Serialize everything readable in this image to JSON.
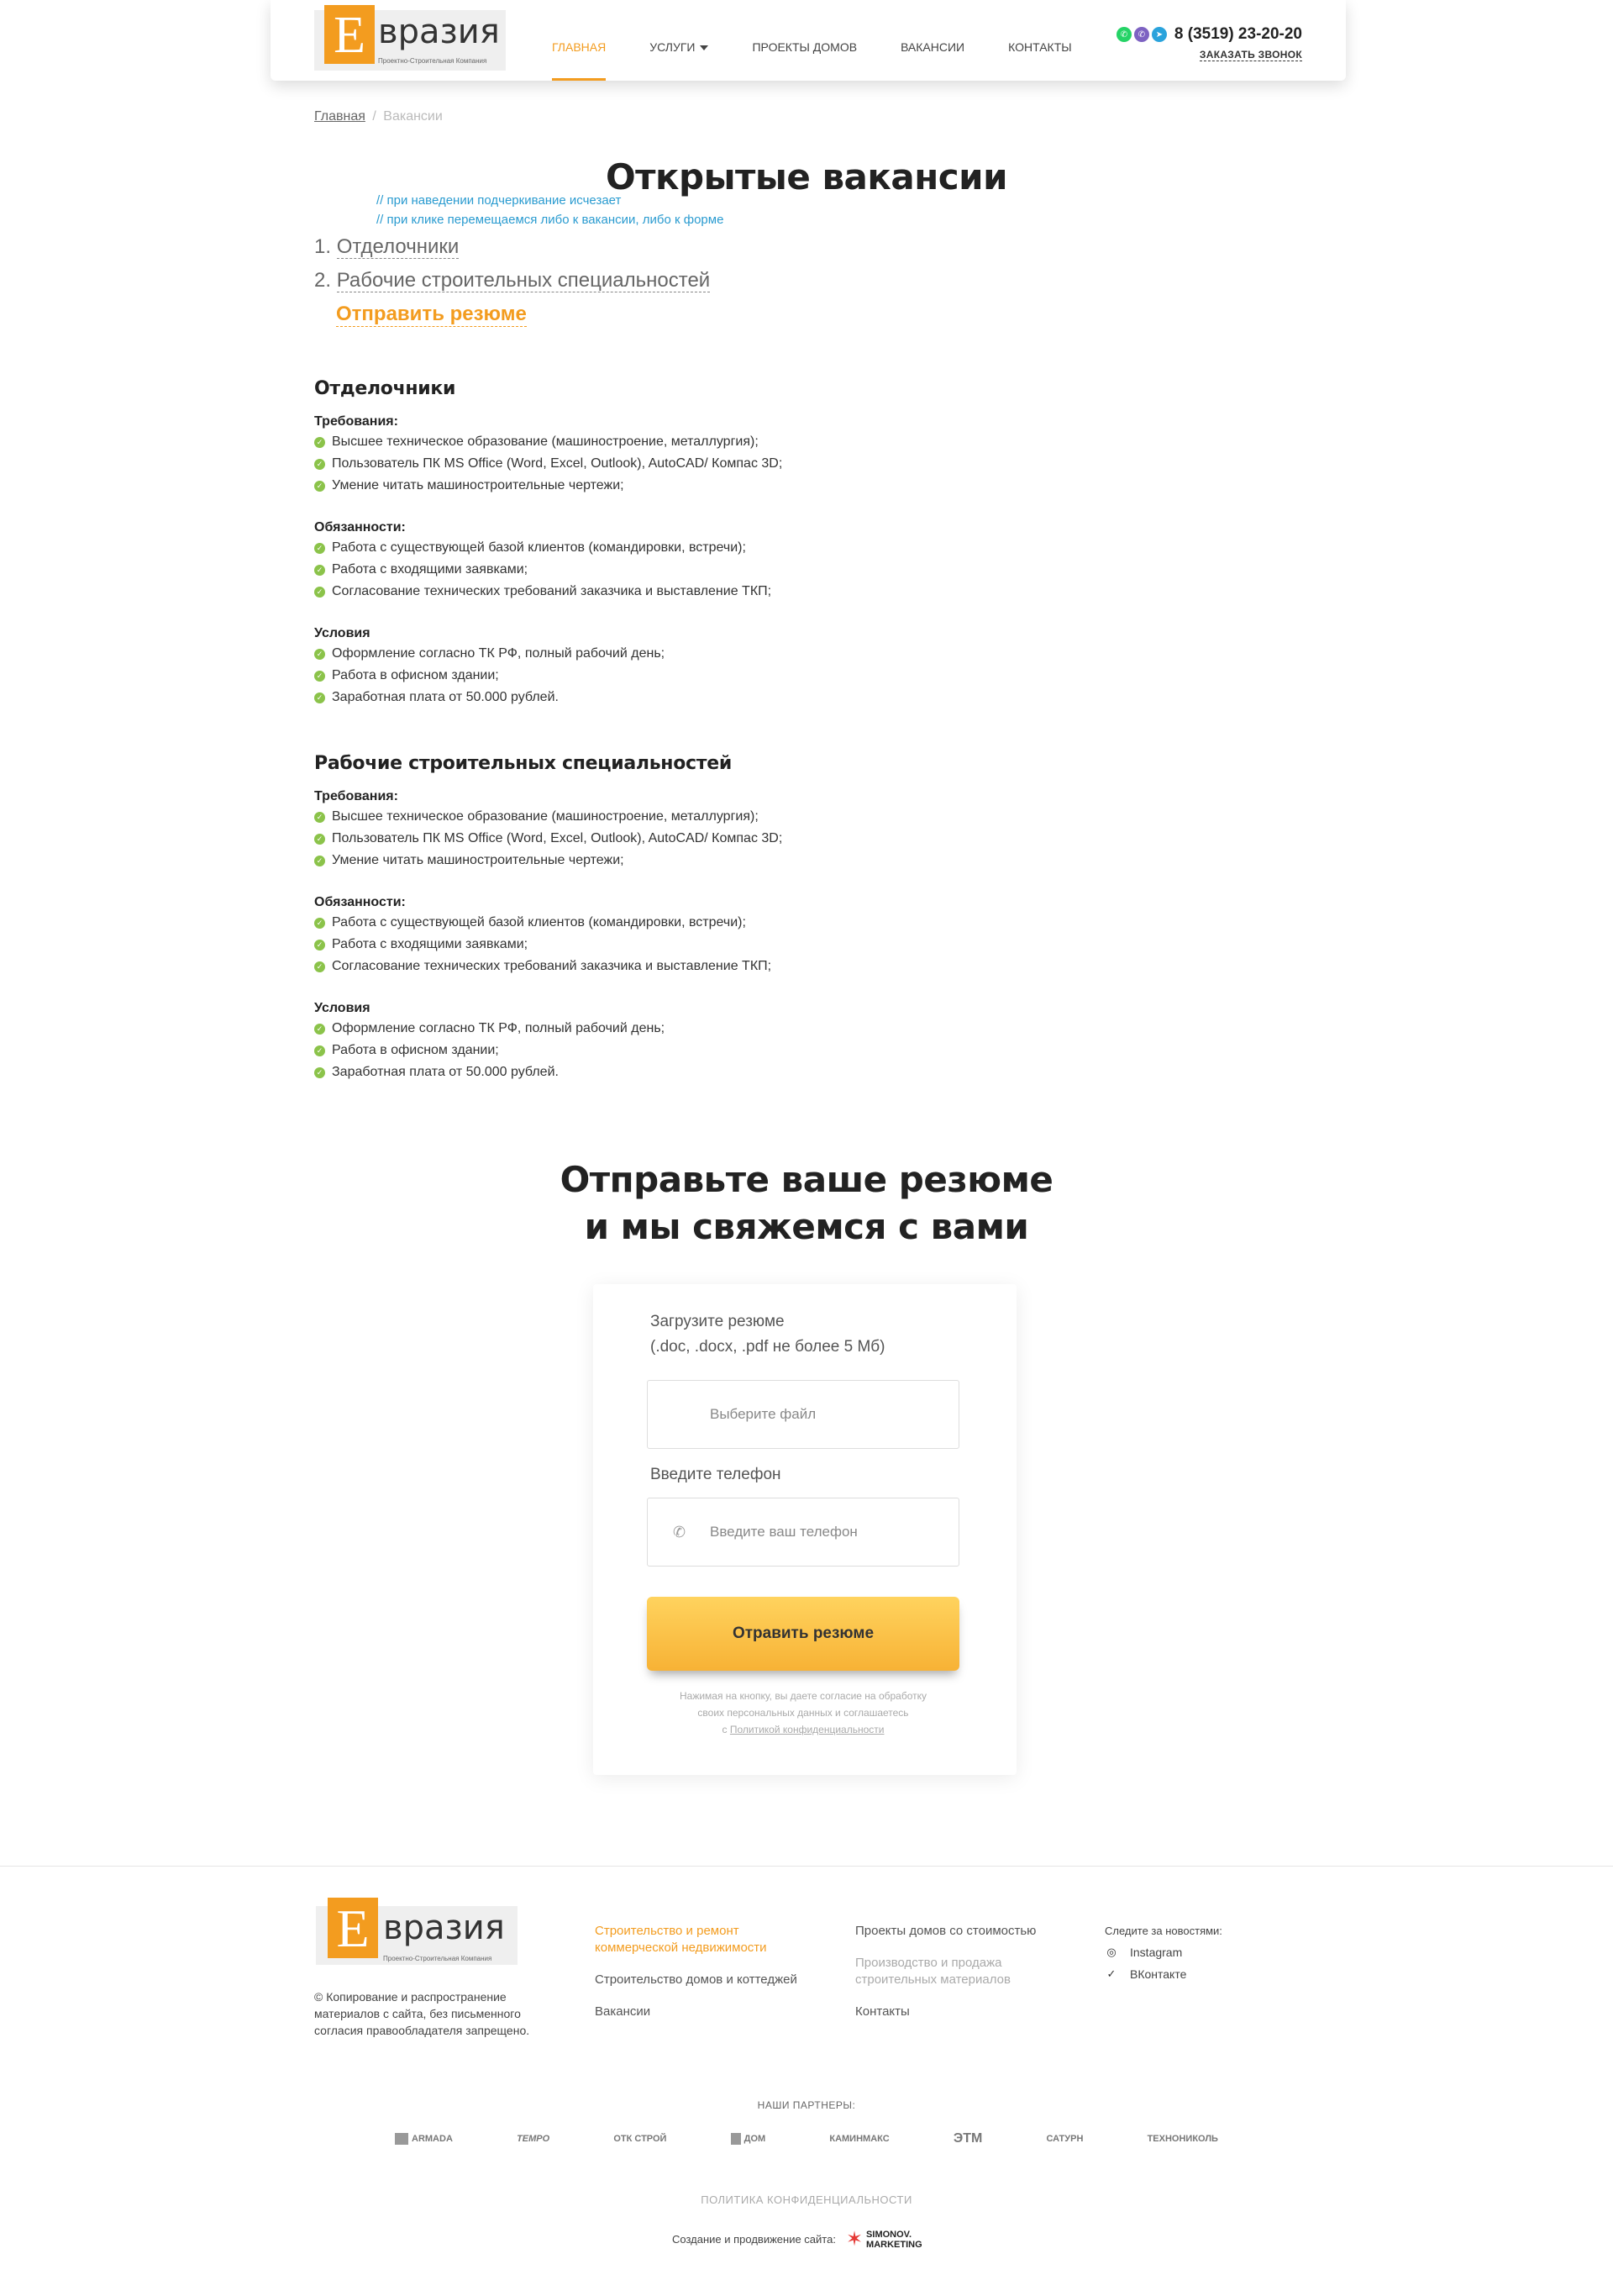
{
  "header": {
    "logo": {
      "letter": "Е",
      "rest": "вразия",
      "subtitle": "Проектно-Строительная Компания"
    },
    "nav": [
      {
        "label": "Главная",
        "active": true
      },
      {
        "label": "Услуги",
        "dropdown": true
      },
      {
        "label": "Проекты домов"
      },
      {
        "label": "Вакансии"
      },
      {
        "label": "Контакты"
      }
    ],
    "messengers": [
      "whatsapp-icon",
      "viber-icon",
      "telegram-icon"
    ],
    "phone": "8 (3519) 23-20-20",
    "callback": "Заказать звонок"
  },
  "breadcrumb": {
    "home": "Главная",
    "separator": "/",
    "current": "Вакансии"
  },
  "title": "Открытые вакансии",
  "dev_notes": [
    "// при наведении подчеркивание исчезает",
    "// при клике перемещаемся либо к вакансии, либо к форме"
  ],
  "toc": {
    "items": [
      {
        "num": "1.",
        "label": "Отделочники"
      },
      {
        "num": "2.",
        "label": "Рабочие строительных специальностей"
      }
    ],
    "resume_link": "Отправить резюме"
  },
  "vacancies": [
    {
      "title": "Отделочники",
      "sections": [
        {
          "heading": "Требования:",
          "items": [
            "Высшее техническое образование (машиностроение, металлургия);",
            "Пользователь ПК MS Office (Word, Excel, Outlook), AutoCAD/ Компас 3D;",
            "Умение читать машиностроительные чертежи;"
          ]
        },
        {
          "heading": "Обязанности:",
          "items": [
            "Работа с существующей базой клиентов (командировки, встречи);",
            "Работа с входящими заявками;",
            "Согласование технических требований заказчика и выставление ТКП;"
          ]
        },
        {
          "heading": "Условия",
          "items": [
            "Оформление согласно ТК РФ, полный рабочий день;",
            "Работа в офисном здании;",
            "Заработная плата от 50.000 рублей."
          ]
        }
      ]
    },
    {
      "title": "Рабочие строительных специальностей",
      "sections": [
        {
          "heading": "Требования:",
          "items": [
            "Высшее техническое образование (машиностроение, металлургия);",
            "Пользователь ПК MS Office (Word, Excel, Outlook), AutoCAD/ Компас 3D;",
            "Умение читать машиностроительные чертежи;"
          ]
        },
        {
          "heading": "Обязанности:",
          "items": [
            "Работа с существующей базой клиентов (командировки, встречи);",
            "Работа с входящими заявками;",
            "Согласование технических требований заказчика и выставление ТКП;"
          ]
        },
        {
          "heading": "Условия",
          "items": [
            "Оформление согласно ТК РФ, полный рабочий день;",
            "Работа в офисном здании;",
            "Заработная плата от 50.000 рублей."
          ]
        }
      ]
    }
  ],
  "form_section": {
    "title_line1": "Отправьте ваше резюме",
    "title_line2": "и мы свяжемся с вами",
    "upload_label_1": "Загрузите резюме",
    "upload_label_2": "(.doc, .docx, .pdf не более 5 Мб)",
    "file_placeholder": "Выберите файл",
    "phone_label": "Введите телефон",
    "phone_placeholder": "Введите ваш телефон",
    "submit": "Отравить резюме",
    "consent_1": "Нажимая на кнопку, вы даете согласие на обработку",
    "consent_2": "своих персональных данных и соглашаетесь",
    "consent_3": "с",
    "consent_link": "Политикой конфиденциальности"
  },
  "footer": {
    "copyright": "© Копирование и распространение материалов с сайта, без письменного согласия правообладателя запрещено.",
    "col1": [
      {
        "label": "Строительство и ремонт коммерческой недвижимости",
        "style": "orange"
      },
      {
        "label": "Строительство домов и коттеджей"
      },
      {
        "label": "Вакансии"
      }
    ],
    "col2": [
      {
        "label": "Проекты домов со стоимостью"
      },
      {
        "label": "Производство и продажа строительных материалов",
        "style": "muted"
      },
      {
        "label": "Контакты"
      }
    ],
    "social_title": "Следите за новостями:",
    "social": [
      {
        "icon": "instagram-icon",
        "label": "Instagram"
      },
      {
        "icon": "vk-icon",
        "label": "ВКонтакте"
      }
    ],
    "partners_title": "Наши партнеры:",
    "partners": [
      "ARMADA",
      "TEMPO",
      "ОТК СТРОЙ",
      "ДОМ",
      "КАМИНМАКС",
      "ЭТМ",
      "САТУРН",
      "ТЕХНОНИКОЛЬ"
    ],
    "policy": "Политика конфиденциальности",
    "made_by": "Создание и продвижение сайта:",
    "dev_brand_1": "SIMONOV.",
    "dev_brand_2": "MARKETING"
  },
  "colors": {
    "accent": "#f39c1f",
    "check": "#8bc34a",
    "note": "#2a9bd0"
  }
}
